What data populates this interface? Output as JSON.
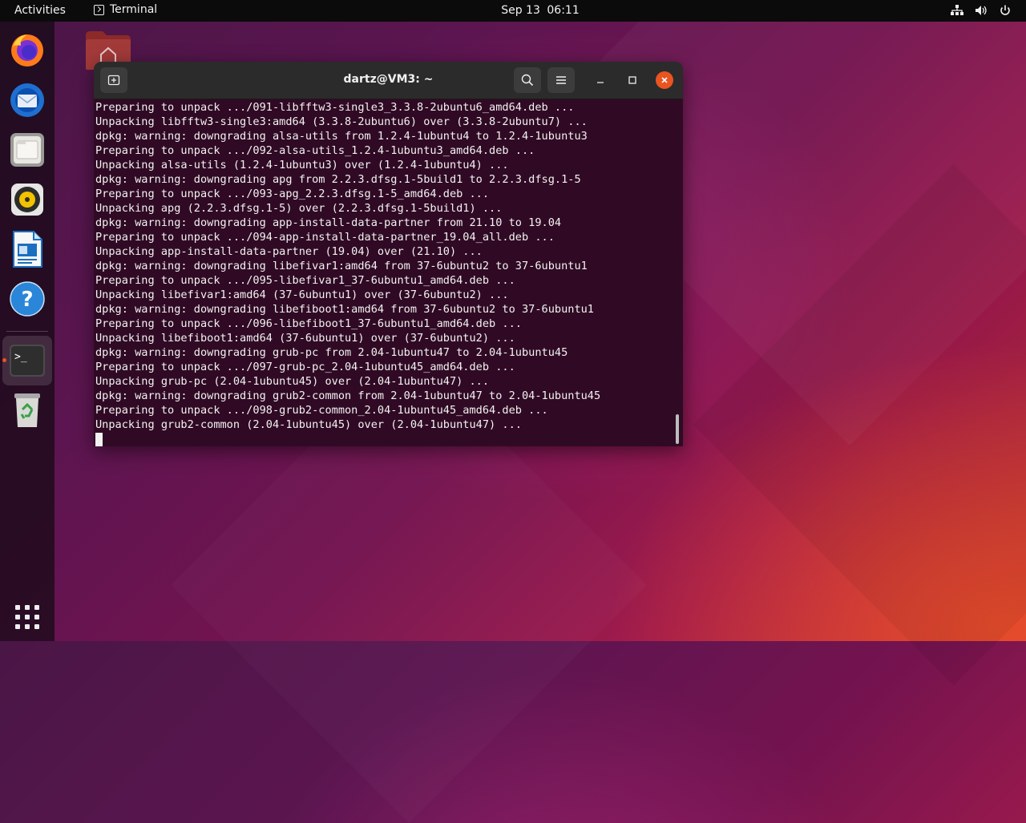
{
  "topbar": {
    "activities": "Activities",
    "app_name": "Terminal",
    "date": "Sep 13",
    "time": "06:11",
    "status_icons": [
      "network-icon",
      "volume-icon",
      "power-icon"
    ]
  },
  "dock": {
    "apps": [
      {
        "name": "firefox-icon",
        "label": "Firefox"
      },
      {
        "name": "thunderbird-icon",
        "label": "Thunderbird"
      },
      {
        "name": "files-icon",
        "label": "Files"
      },
      {
        "name": "rhythmbox-icon",
        "label": "Rhythmbox"
      },
      {
        "name": "writer-icon",
        "label": "LibreOffice Writer"
      },
      {
        "name": "help-icon",
        "label": "Help"
      },
      {
        "name": "terminal-icon",
        "label": "Terminal",
        "active": true
      },
      {
        "name": "trash-icon",
        "label": "Trash"
      }
    ],
    "show_apps": "show-apps-icon"
  },
  "desktop": {
    "home_folder_icon": "home-folder-icon"
  },
  "terminal": {
    "title": "dartz@VM3: ~",
    "lines": [
      "Preparing to unpack .../091-libfftw3-single3_3.3.8-2ubuntu6_amd64.deb ...",
      "Unpacking libfftw3-single3:amd64 (3.3.8-2ubuntu6) over (3.3.8-2ubuntu7) ...",
      "dpkg: warning: downgrading alsa-utils from 1.2.4-1ubuntu4 to 1.2.4-1ubuntu3",
      "Preparing to unpack .../092-alsa-utils_1.2.4-1ubuntu3_amd64.deb ...",
      "Unpacking alsa-utils (1.2.4-1ubuntu3) over (1.2.4-1ubuntu4) ...",
      "dpkg: warning: downgrading apg from 2.2.3.dfsg.1-5build1 to 2.2.3.dfsg.1-5",
      "Preparing to unpack .../093-apg_2.2.3.dfsg.1-5_amd64.deb ...",
      "Unpacking apg (2.2.3.dfsg.1-5) over (2.2.3.dfsg.1-5build1) ...",
      "dpkg: warning: downgrading app-install-data-partner from 21.10 to 19.04",
      "Preparing to unpack .../094-app-install-data-partner_19.04_all.deb ...",
      "Unpacking app-install-data-partner (19.04) over (21.10) ...",
      "dpkg: warning: downgrading libefivar1:amd64 from 37-6ubuntu2 to 37-6ubuntu1",
      "Preparing to unpack .../095-libefivar1_37-6ubuntu1_amd64.deb ...",
      "Unpacking libefivar1:amd64 (37-6ubuntu1) over (37-6ubuntu2) ...",
      "dpkg: warning: downgrading libefiboot1:amd64 from 37-6ubuntu2 to 37-6ubuntu1",
      "Preparing to unpack .../096-libefiboot1_37-6ubuntu1_amd64.deb ...",
      "Unpacking libefiboot1:amd64 (37-6ubuntu1) over (37-6ubuntu2) ...",
      "dpkg: warning: downgrading grub-pc from 2.04-1ubuntu47 to 2.04-1ubuntu45",
      "Preparing to unpack .../097-grub-pc_2.04-1ubuntu45_amd64.deb ...",
      "Unpacking grub-pc (2.04-1ubuntu45) over (2.04-1ubuntu47) ...",
      "dpkg: warning: downgrading grub2-common from 2.04-1ubuntu47 to 2.04-1ubuntu45",
      "Preparing to unpack .../098-grub2-common_2.04-1ubuntu45_amd64.deb ...",
      "Unpacking grub2-common (2.04-1ubuntu45) over (2.04-1ubuntu47) ..."
    ]
  },
  "colors": {
    "accent": "#e95420",
    "terminal_bg": "#300a24",
    "titlebar_bg": "#2b2b2b",
    "topbar_bg": "#0b0b0b"
  }
}
